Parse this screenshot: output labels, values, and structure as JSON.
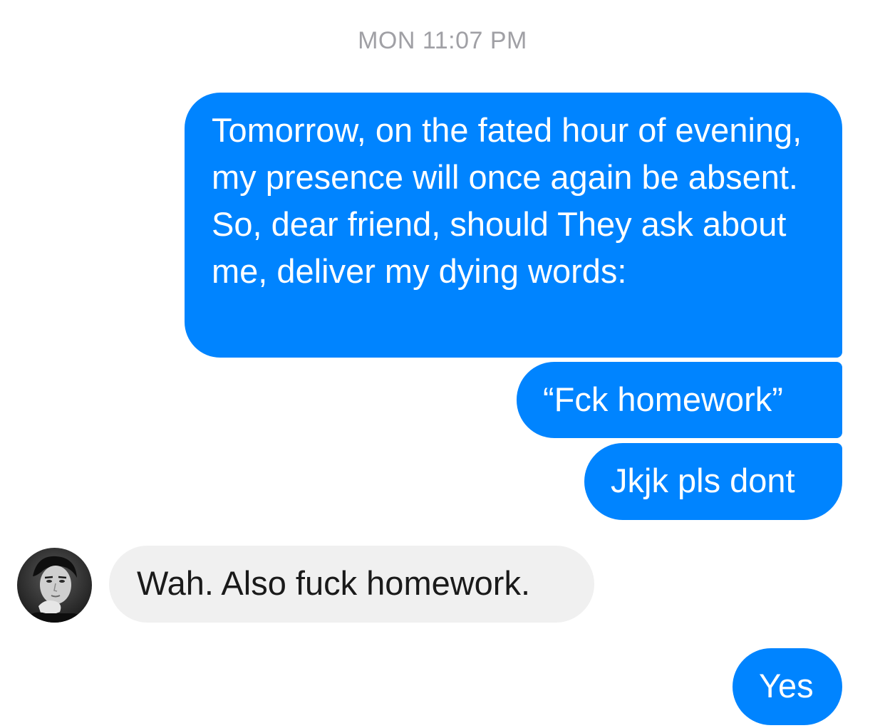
{
  "thread": {
    "timestamp": "MON 11:07 PM",
    "messages": [
      {
        "direction": "sent",
        "text": "Tomorrow, on the fated hour of evening, my presence will once again be absent. So, dear friend, should They ask about me, deliver my dying words:"
      },
      {
        "direction": "sent",
        "text": "“Fck homework”"
      },
      {
        "direction": "sent",
        "text": "Jkjk pls dont"
      },
      {
        "direction": "received",
        "text": "Wah. Also fuck homework.",
        "avatar": "contact-avatar"
      },
      {
        "direction": "sent",
        "text": "Yes"
      }
    ]
  },
  "colors": {
    "sent_bubble": "#0084ff",
    "received_bubble": "#f0f0f0",
    "timestamp": "#a0a0a5"
  }
}
